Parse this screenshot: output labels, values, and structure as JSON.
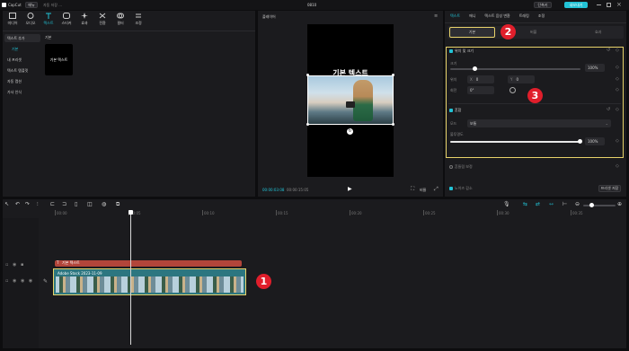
{
  "titlebar": {
    "app": "CapCut",
    "menu": "메뉴",
    "autosave": "자동 저장 ...",
    "project_title": "0810",
    "shortcuts": "단축키",
    "export": "내보내기"
  },
  "toolbar": {
    "tabs": [
      {
        "label": "미디어"
      },
      {
        "label": "오디오"
      },
      {
        "label": "텍스트"
      },
      {
        "label": "스티커"
      },
      {
        "label": "효과"
      },
      {
        "label": "전환"
      },
      {
        "label": "필터"
      },
      {
        "label": "조정"
      }
    ]
  },
  "library": {
    "sidebar": [
      {
        "label": "텍스트 추가"
      },
      {
        "label": "기본"
      },
      {
        "label": "내 프리셋"
      },
      {
        "label": "텍스트 템플릿"
      },
      {
        "label": "자동 캡션"
      },
      {
        "label": "가사 인식"
      }
    ],
    "section": "기본",
    "default_card": "기본 텍스트"
  },
  "player": {
    "title": "플레이어",
    "caption": "기본 텍스트",
    "timecode": "00:00:03:08",
    "duration": "00:00:15:05",
    "ratio": "비율"
  },
  "inspector": {
    "tabs": [
      {
        "label": "텍스트"
      },
      {
        "label": "애니"
      },
      {
        "label": "텍스트 음성 변환"
      },
      {
        "label": "트래킹"
      },
      {
        "label": "조정"
      }
    ],
    "subtabs": [
      {
        "label": "기본"
      },
      {
        "label": "버블"
      },
      {
        "label": "효과"
      }
    ],
    "position_section": "위치 및 크기",
    "scale_label": "크기",
    "scale_value": "100%",
    "position_label": "위치",
    "pos_x_label": "X",
    "pos_x": "0",
    "pos_y_label": "Y",
    "pos_y": "0",
    "rotate_label": "회전",
    "rotate_value": "0°",
    "blend_section": "혼합",
    "mode_label": "모드",
    "mode_value": "보통",
    "opacity_label": "불투명도",
    "opacity_value": "100%",
    "stabilize_label": "흔들림 보정",
    "noise_label": "노이즈 감소",
    "save_preset": "프리셋 저장"
  },
  "timeline": {
    "ticks": [
      "00:00",
      "00:05",
      "00:10",
      "00:15",
      "00:20",
      "00:25",
      "00:30",
      "00:35"
    ],
    "text_clip": "기본 텍스트",
    "video_clip": "Adobe Stock 2023-11-09"
  },
  "annotations": [
    {
      "label": "1"
    },
    {
      "label": "2"
    },
    {
      "label": "3"
    }
  ],
  "colors": {
    "accent": "#22c3d6",
    "highlight": "#e8d36a",
    "badge": "#e01e2b",
    "text_clip": "#b2453a",
    "video_clip": "#2c7680"
  }
}
